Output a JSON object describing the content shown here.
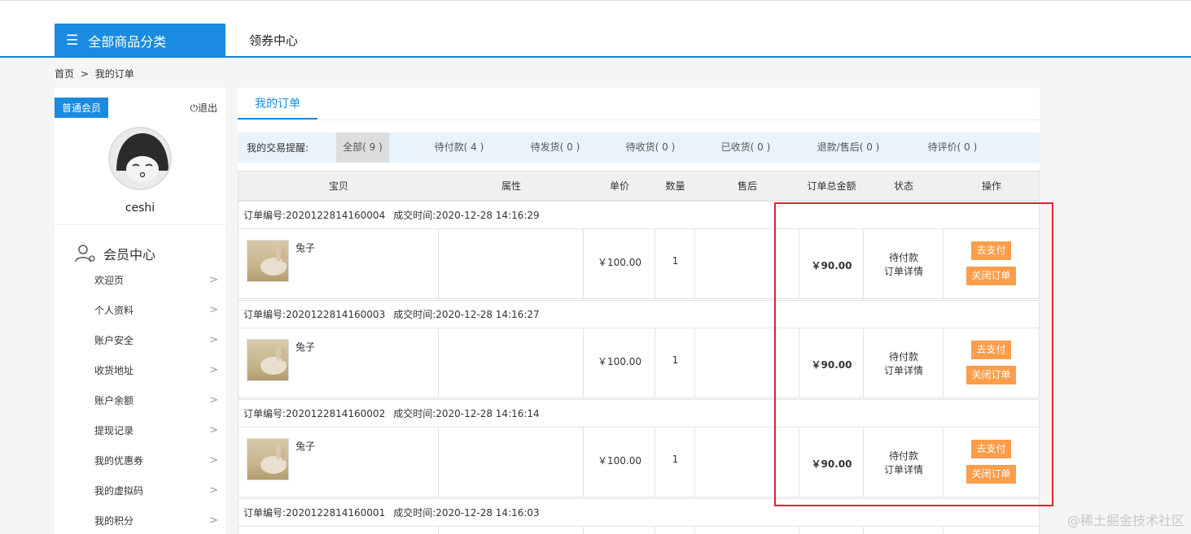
{
  "header": {
    "category_label": "全部商品分类",
    "coupon_link": "领券中心"
  },
  "breadcrumb": {
    "home": "首页",
    "separator": ">",
    "current": "我的订单"
  },
  "sidebar": {
    "member_badge": "普通会员",
    "logout": "退出",
    "username": "ceshi",
    "member_center": "会员中心",
    "items": [
      {
        "label": "欢迎页"
      },
      {
        "label": "个人资料"
      },
      {
        "label": "账户安全"
      },
      {
        "label": "收货地址"
      },
      {
        "label": "账户余额"
      },
      {
        "label": "提现记录"
      },
      {
        "label": "我的优惠券"
      },
      {
        "label": "我的虚拟码"
      },
      {
        "label": "我的积分"
      }
    ]
  },
  "main": {
    "tab_label": "我的订单",
    "filter_label": "我的交易提醒:",
    "filters": [
      {
        "label": "全部( 9 )"
      },
      {
        "label": "待付款( 4 )"
      },
      {
        "label": "待发货( 0 )"
      },
      {
        "label": "待收货( 0 )"
      },
      {
        "label": "已收货( 0 )"
      },
      {
        "label": "退款/售后( 0 )"
      },
      {
        "label": "待评价( 0 )"
      }
    ],
    "columns": [
      "宝贝",
      "属性",
      "单价",
      "数量",
      "售后",
      "订单总金额",
      "状态",
      "操作"
    ],
    "orders": [
      {
        "order_no": "订单编号:2020122814160004",
        "time": "成交时间:2020-12-28 14:16:29",
        "product": "兔子",
        "price": "￥100.00",
        "qty": "1",
        "total": "￥90.00",
        "status": "待付款",
        "detail": "订单详情",
        "pay": "去支付",
        "close": "关闭订单"
      },
      {
        "order_no": "订单编号:2020122814160003",
        "time": "成交时间:2020-12-28 14:16:27",
        "product": "兔子",
        "price": "￥100.00",
        "qty": "1",
        "total": "￥90.00",
        "status": "待付款",
        "detail": "订单详情",
        "pay": "去支付",
        "close": "关闭订单"
      },
      {
        "order_no": "订单编号:2020122814160002",
        "time": "成交时间:2020-12-28 14:16:14",
        "product": "兔子",
        "price": "￥100.00",
        "qty": "1",
        "total": "￥90.00",
        "status": "待付款",
        "detail": "订单详情",
        "pay": "去支付",
        "close": "关闭订单"
      },
      {
        "order_no": "订单编号:2020122814160001",
        "time": "成交时间:2020-12-28 14:16:03"
      }
    ]
  },
  "watermark": "@稀土掘金技术社区",
  "colors": {
    "accent": "#1a8be0",
    "button": "#fe9d4a",
    "highlight": "#e0242e"
  }
}
